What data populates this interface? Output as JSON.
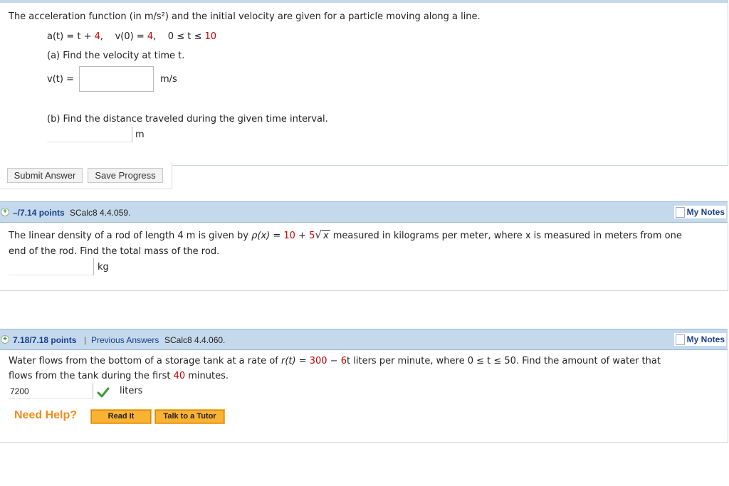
{
  "q1": {
    "intro": "The acceleration function (in m/s²) and the initial velocity are given for a particle moving along a line.",
    "given": {
      "a_lhs": "a(t) = t + ",
      "a_val": "4",
      "v_lhs": "v(0) = ",
      "v_val": "4",
      "interval_lhs": "0 ≤ t ≤ ",
      "interval_val": "10"
    },
    "part_a": "(a) Find the velocity at time t.",
    "v_label": "v(t) =",
    "v_unit": "m/s",
    "v_value": "",
    "part_b": "(b) Find the distance traveled during the given time interval.",
    "dist_unit": "m",
    "dist_value": ""
  },
  "actions": {
    "submit": "Submit Answer",
    "save": "Save Progress"
  },
  "q2": {
    "points": "–/7.14 points",
    "code": "SCalc8 4.4.059.",
    "notes": "My Notes",
    "text_a": "The linear density of a rod of length 4 m is given by ",
    "rho": "ρ(x) = ",
    "c1": "10",
    "plus": " + ",
    "c2": "5",
    "radicand": "x",
    "text_b": " measured in kilograms per meter, where x is measured in meters from one",
    "text_c": "end of the rod. Find the total mass of the rod.",
    "unit": "kg",
    "value": ""
  },
  "q3": {
    "points": "7.18/7.18 points",
    "sep": "|",
    "prev": "Previous Answers",
    "code": "SCalc8 4.4.060.",
    "notes": "My Notes",
    "text_a": "Water flows from the bottom of a storage tank at a rate of ",
    "r": "r(t) = ",
    "c1": "300",
    "minus": " − ",
    "c2": "6",
    "text_b": "t liters per minute, where 0 ≤ t ≤ 50. Find the amount of water that",
    "text_c": "flows from the tank during the first ",
    "minutes_val": "40",
    "text_d": " minutes.",
    "answer": "7200",
    "unit": "liters",
    "need_help": "Need Help?",
    "read_it": "Read It",
    "tutor": "Talk to a Tutor"
  },
  "colors": {
    "accent_red": "#cc0000",
    "link_blue": "#1a3f8f",
    "header_bg": "#c5d9ec",
    "help_orange": "#f28c1c",
    "button_orange": "#f9b233"
  }
}
